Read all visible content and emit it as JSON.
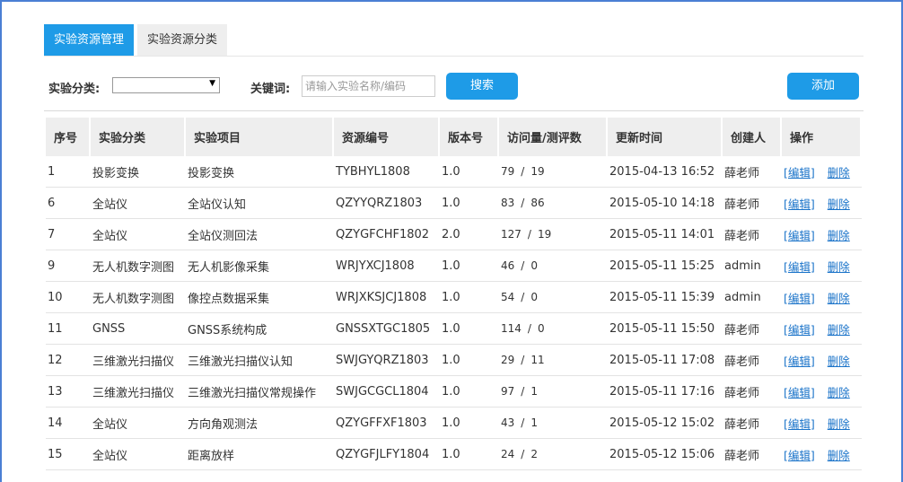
{
  "tabs": [
    {
      "label": "实验资源管理",
      "active": true
    },
    {
      "label": "实验资源分类",
      "active": false
    }
  ],
  "filters": {
    "category_label": "实验分类:",
    "category_value": "",
    "keyword_label": "关键词:",
    "keyword_placeholder": "请输入实验名称/编码",
    "search_label": "搜索",
    "add_label": "添加"
  },
  "table": {
    "headers": [
      "序号",
      "实验分类",
      "实验项目",
      "资源编号",
      "版本号",
      "访问量/测评数",
      "更新时间",
      "创建人",
      "操作"
    ],
    "rows": [
      {
        "id": "1",
        "category": "投影变换",
        "project": "投影变换",
        "code": "TYBHYL1808",
        "version": "1.0",
        "visits": "79",
        "reviews": "19",
        "updated": "2015-04-13 16:52",
        "creator": "薛老师",
        "edit": "[编辑]",
        "delete": "删除"
      },
      {
        "id": "6",
        "category": "全站仪",
        "project": "全站仪认知",
        "code": "QZYYQRZ1803",
        "version": "1.0",
        "visits": "83",
        "reviews": "86",
        "updated": "2015-05-10 14:18",
        "creator": "薛老师",
        "edit": "[编辑]",
        "delete": "删除"
      },
      {
        "id": "7",
        "category": "全站仪",
        "project": "全站仪测回法",
        "code": "QZYGFCHF1802",
        "version": "2.0",
        "visits": "127",
        "reviews": "19",
        "updated": "2015-05-11 14:01",
        "creator": "薛老师",
        "edit": "[编辑]",
        "delete": "删除"
      },
      {
        "id": "9",
        "category": "无人机数字测图",
        "project": "无人机影像采集",
        "code": "WRJYXCJ1808",
        "version": "1.0",
        "visits": "46",
        "reviews": "0",
        "updated": "2015-05-11 15:25",
        "creator": "admin",
        "edit": "[编辑]",
        "delete": "删除"
      },
      {
        "id": "10",
        "category": "无人机数字测图",
        "project": "像控点数据采集",
        "code": "WRJXKSJCJ1808",
        "version": "1.0",
        "visits": "54",
        "reviews": "0",
        "updated": "2015-05-11 15:39",
        "creator": "admin",
        "edit": "[编辑]",
        "delete": "删除"
      },
      {
        "id": "11",
        "category": "GNSS",
        "project": "GNSS系统构成",
        "code": "GNSSXTGC1805",
        "version": "1.0",
        "visits": "114",
        "reviews": "0",
        "updated": "2015-05-11 15:50",
        "creator": "薛老师",
        "edit": "[编辑]",
        "delete": "删除"
      },
      {
        "id": "12",
        "category": "三维激光扫描仪",
        "project": "三维激光扫描仪认知",
        "code": "SWJGYQRZ1803",
        "version": "1.0",
        "visits": "29",
        "reviews": "11",
        "updated": "2015-05-11 17:08",
        "creator": "薛老师",
        "edit": "[编辑]",
        "delete": "删除"
      },
      {
        "id": "13",
        "category": "三维激光扫描仪",
        "project": "三维激光扫描仪常规操作",
        "code": "SWJGCGCL1804",
        "version": "1.0",
        "visits": "97",
        "reviews": "1",
        "updated": "2015-05-11 17:16",
        "creator": "薛老师",
        "edit": "[编辑]",
        "delete": "删除"
      },
      {
        "id": "14",
        "category": "全站仪",
        "project": "方向角观测法",
        "code": "QZYGFFXF1803",
        "version": "1.0",
        "visits": "43",
        "reviews": "1",
        "updated": "2015-05-12 15:02",
        "creator": "薛老师",
        "edit": "[编辑]",
        "delete": "删除"
      },
      {
        "id": "15",
        "category": "全站仪",
        "project": "距离放样",
        "code": "QZYGFJLFY1804",
        "version": "1.0",
        "visits": "24",
        "reviews": "2",
        "updated": "2015-05-12 15:06",
        "creator": "薛老师",
        "edit": "[编辑]",
        "delete": "删除"
      }
    ]
  },
  "colors": {
    "accent": "#1e9be7",
    "frame": "#4a7fd4",
    "link": "#1a73c9"
  }
}
